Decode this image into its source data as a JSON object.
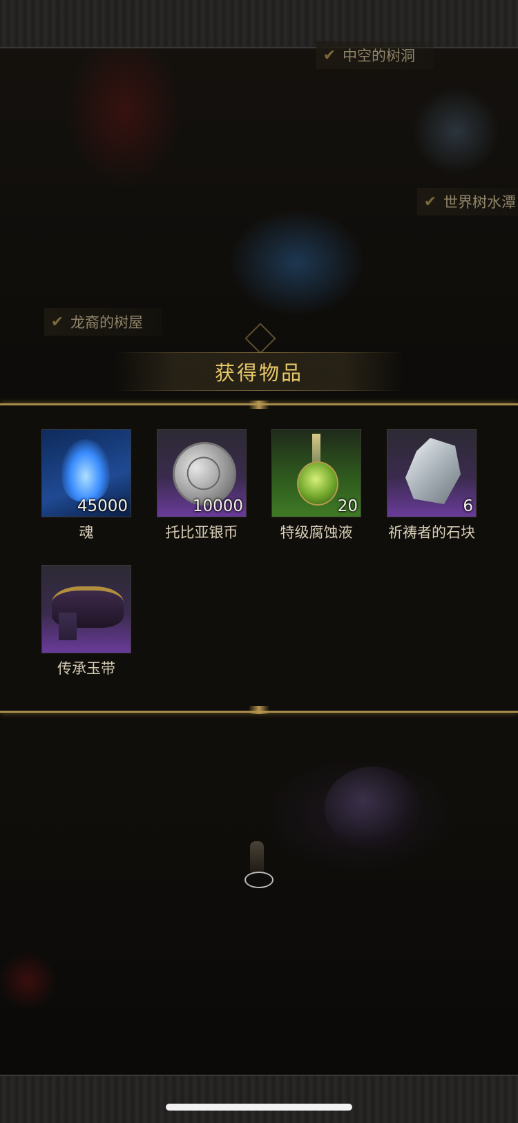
{
  "map_labels": [
    {
      "text": "中空的树洞"
    },
    {
      "text": "世界树水潭"
    },
    {
      "text": "龙裔的树屋"
    }
  ],
  "dialog": {
    "title": "获得物品",
    "items": [
      {
        "name": "魂",
        "quantity": "45000",
        "icon": "blue-soul-flame-icon",
        "rarity_color": "#1f4a93"
      },
      {
        "name": "托比亚银币",
        "quantity": "10000",
        "icon": "silver-coin-icon",
        "rarity_color": "#6a3b9a"
      },
      {
        "name": "特级腐蚀液",
        "quantity": "20",
        "icon": "green-potion-icon",
        "rarity_color": "#3f7a25"
      },
      {
        "name": "祈祷者的石块",
        "quantity": "6",
        "icon": "crystal-stone-icon",
        "rarity_color": "#6a3b9a"
      },
      {
        "name": "传承玉带",
        "quantity": "",
        "icon": "jade-belt-icon",
        "rarity_color": "#6a3b9a"
      }
    ]
  },
  "colors": {
    "gold_accent": "#a78b4a",
    "title_text": "#e8c96a"
  }
}
